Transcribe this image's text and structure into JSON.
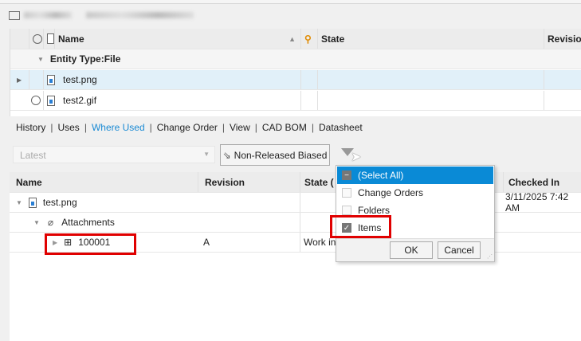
{
  "grid_top": {
    "columns": {
      "name": "Name",
      "state": "State",
      "revision": "Revision"
    },
    "group": "Entity Type:File",
    "rows": [
      {
        "name": "test.png",
        "selected": true
      },
      {
        "name": "test2.gif",
        "selected": false
      }
    ]
  },
  "tabs": [
    {
      "label": "History"
    },
    {
      "label": "Uses"
    },
    {
      "label": "Where Used",
      "active": true
    },
    {
      "label": "Change Order"
    },
    {
      "label": "View"
    },
    {
      "label": "CAD BOM"
    },
    {
      "label": "Datasheet"
    }
  ],
  "toolbar": {
    "version_combo": "Latest",
    "bias_button": "Non-Released Biased"
  },
  "grid_bottom": {
    "columns": {
      "name": "Name",
      "revision": "Revision",
      "state": "State (",
      "checked_in": "Checked In"
    },
    "rows": [
      {
        "name": "test.png",
        "revision": "",
        "state": "",
        "checked_in": "3/11/2025 7:42 AM"
      },
      {
        "name": "Attachments"
      },
      {
        "name": "100001",
        "revision": "A",
        "state": "Work in"
      }
    ]
  },
  "filter_popup": {
    "options": [
      {
        "label": "(Select All)",
        "state": "partial"
      },
      {
        "label": "Change Orders",
        "state": "unchecked"
      },
      {
        "label": "Folders",
        "state": "unchecked"
      },
      {
        "label": "Items",
        "state": "checked"
      }
    ],
    "ok": "OK",
    "cancel": "Cancel"
  },
  "colors": {
    "accent": "#1a8ad4",
    "selection": "#0a8ad6",
    "highlight": "#e00000",
    "row_selected": "#e1f0f9"
  }
}
